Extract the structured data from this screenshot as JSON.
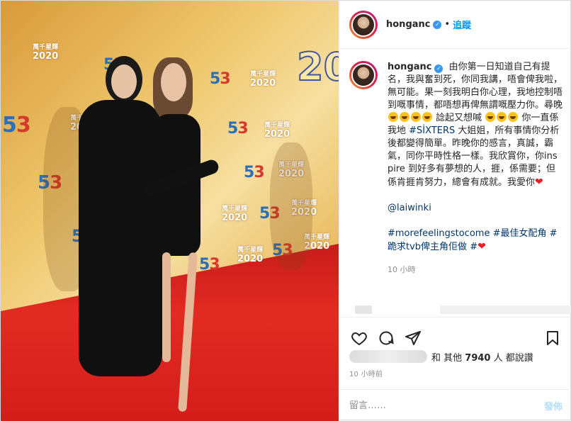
{
  "header": {
    "username": "honganc",
    "verified_icon": "verified-badge-icon",
    "separator": "•",
    "follow_label": "追蹤"
  },
  "caption": {
    "username": "honganc",
    "body_1": "由你第一日知道自己有提名，我與奮到死，你同我講，唔會俾我啦，無可能。果一刻我明白你心理，我地控制唔到嘅事情，都唔想再俾無謂嘅壓力你。尋晚",
    "body_2": "諗起又想喊",
    "body_3": "你一直係我地",
    "hashtag_sixters": "#SİXTERS",
    "body_4": "大姐姐，所有事情你分析後都變得簡單。昨晚你的感言，真誠，霸氣，同你平時性格一樣。我欣賞你，你inspire 到好多有夢想的人，捱，係需要；但係肯捱肯努力，總會有成就。我愛你",
    "mention": "@laiwinki",
    "hashtag_1": "#morefeelingstocome",
    "hashtag_2": "#最佳女配角",
    "hashtag_3": "#",
    "hashtag_4": "跪求tvb俾主角佢做",
    "hashtag_5": "#",
    "time_ago": "10 小時"
  },
  "likes": {
    "prefix": "和 其他",
    "count": "7940",
    "suffix": "人 都說讚"
  },
  "post_time": "10 小時前",
  "comment": {
    "placeholder": "留言……",
    "post_label": "發佈"
  },
  "photo": {
    "banner_numbers": [
      "53",
      "53",
      "53",
      "53",
      "53",
      "53",
      "53",
      "53",
      "53",
      "53"
    ],
    "award_year": "2020",
    "big_year": "20"
  },
  "colors": {
    "accent": "#0095f6",
    "link": "#00376b",
    "heart": "#ed1c24",
    "post_disabled": "#b2dffc"
  },
  "icons": [
    "like-heart-icon",
    "comment-icon",
    "share-icon",
    "save-bookmark-icon"
  ]
}
